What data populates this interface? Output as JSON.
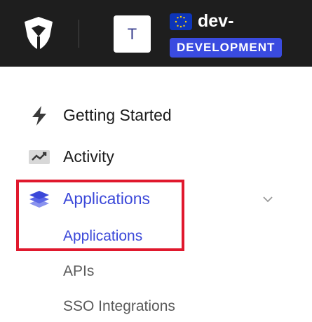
{
  "header": {
    "tenant_initial": "T",
    "tenant_name": "dev-",
    "environment_badge": "DEVELOPMENT"
  },
  "sidebar": {
    "items": [
      {
        "label": "Getting Started",
        "icon": "lightning-icon"
      },
      {
        "label": "Activity",
        "icon": "trend-chart-icon"
      },
      {
        "label": "Applications",
        "icon": "layers-icon",
        "active": true,
        "expanded": true
      }
    ],
    "sub_items": [
      {
        "label": "Applications",
        "active": true
      },
      {
        "label": "APIs"
      },
      {
        "label": "SSO Integrations"
      }
    ]
  },
  "colors": {
    "topbar": "#1e1e1e",
    "accent": "#3b48d9",
    "badge": "#3a4be0",
    "highlight": "#e0182d"
  }
}
